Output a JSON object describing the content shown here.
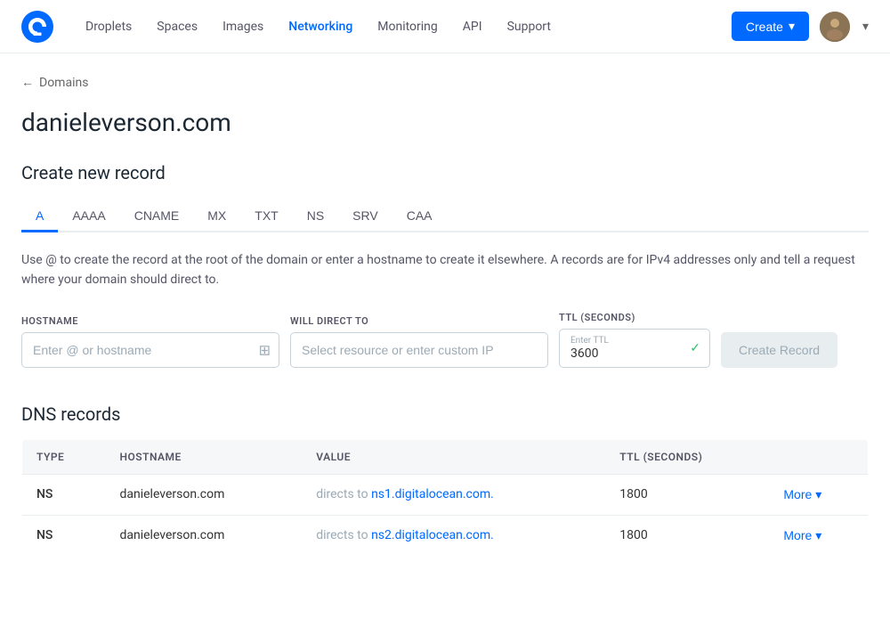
{
  "nav": {
    "links": [
      {
        "id": "droplets",
        "label": "Droplets",
        "active": false
      },
      {
        "id": "spaces",
        "label": "Spaces",
        "active": false
      },
      {
        "id": "images",
        "label": "Images",
        "active": false
      },
      {
        "id": "networking",
        "label": "Networking",
        "active": true
      },
      {
        "id": "monitoring",
        "label": "Monitoring",
        "active": false
      },
      {
        "id": "api",
        "label": "API",
        "active": false
      },
      {
        "id": "support",
        "label": "Support",
        "active": false
      }
    ],
    "create_label": "Create",
    "caret": "▾"
  },
  "breadcrumb": {
    "back_arrow": "←",
    "label": "Domains"
  },
  "page": {
    "domain": "danieleverson.com",
    "create_section_title": "Create new record"
  },
  "record_tabs": [
    {
      "id": "a",
      "label": "A",
      "active": true
    },
    {
      "id": "aaaa",
      "label": "AAAA",
      "active": false
    },
    {
      "id": "cname",
      "label": "CNAME",
      "active": false
    },
    {
      "id": "mx",
      "label": "MX",
      "active": false
    },
    {
      "id": "txt",
      "label": "TXT",
      "active": false
    },
    {
      "id": "ns",
      "label": "NS",
      "active": false
    },
    {
      "id": "srv",
      "label": "SRV",
      "active": false
    },
    {
      "id": "caa",
      "label": "CAA",
      "active": false
    }
  ],
  "description": "Use @ to create the record at the root of the domain or enter a hostname to create it elsewhere. A records are for IPv4 addresses only and tell a request where your domain should direct to.",
  "form": {
    "hostname_label": "HOSTNAME",
    "hostname_placeholder": "Enter @ or hostname",
    "will_direct_label": "WILL DIRECT TO",
    "will_direct_placeholder": "Select resource or enter custom IP",
    "ttl_label": "TTL (SECONDS)",
    "ttl_inner_label": "Enter TTL",
    "ttl_value": "3600",
    "create_btn_label": "Create Record"
  },
  "dns": {
    "section_title": "DNS records",
    "columns": [
      "Type",
      "Hostname",
      "Value",
      "TTL (seconds)",
      ""
    ],
    "rows": [
      {
        "type": "NS",
        "hostname": "danieleverson.com",
        "directs_prefix": "directs to",
        "value": "ns1.digitalocean.com.",
        "ttl": "1800",
        "more_label": "More"
      },
      {
        "type": "NS",
        "hostname": "danieleverson.com",
        "directs_prefix": "directs to",
        "value": "ns2.digitalocean.com.",
        "ttl": "1800",
        "more_label": "More"
      }
    ]
  }
}
